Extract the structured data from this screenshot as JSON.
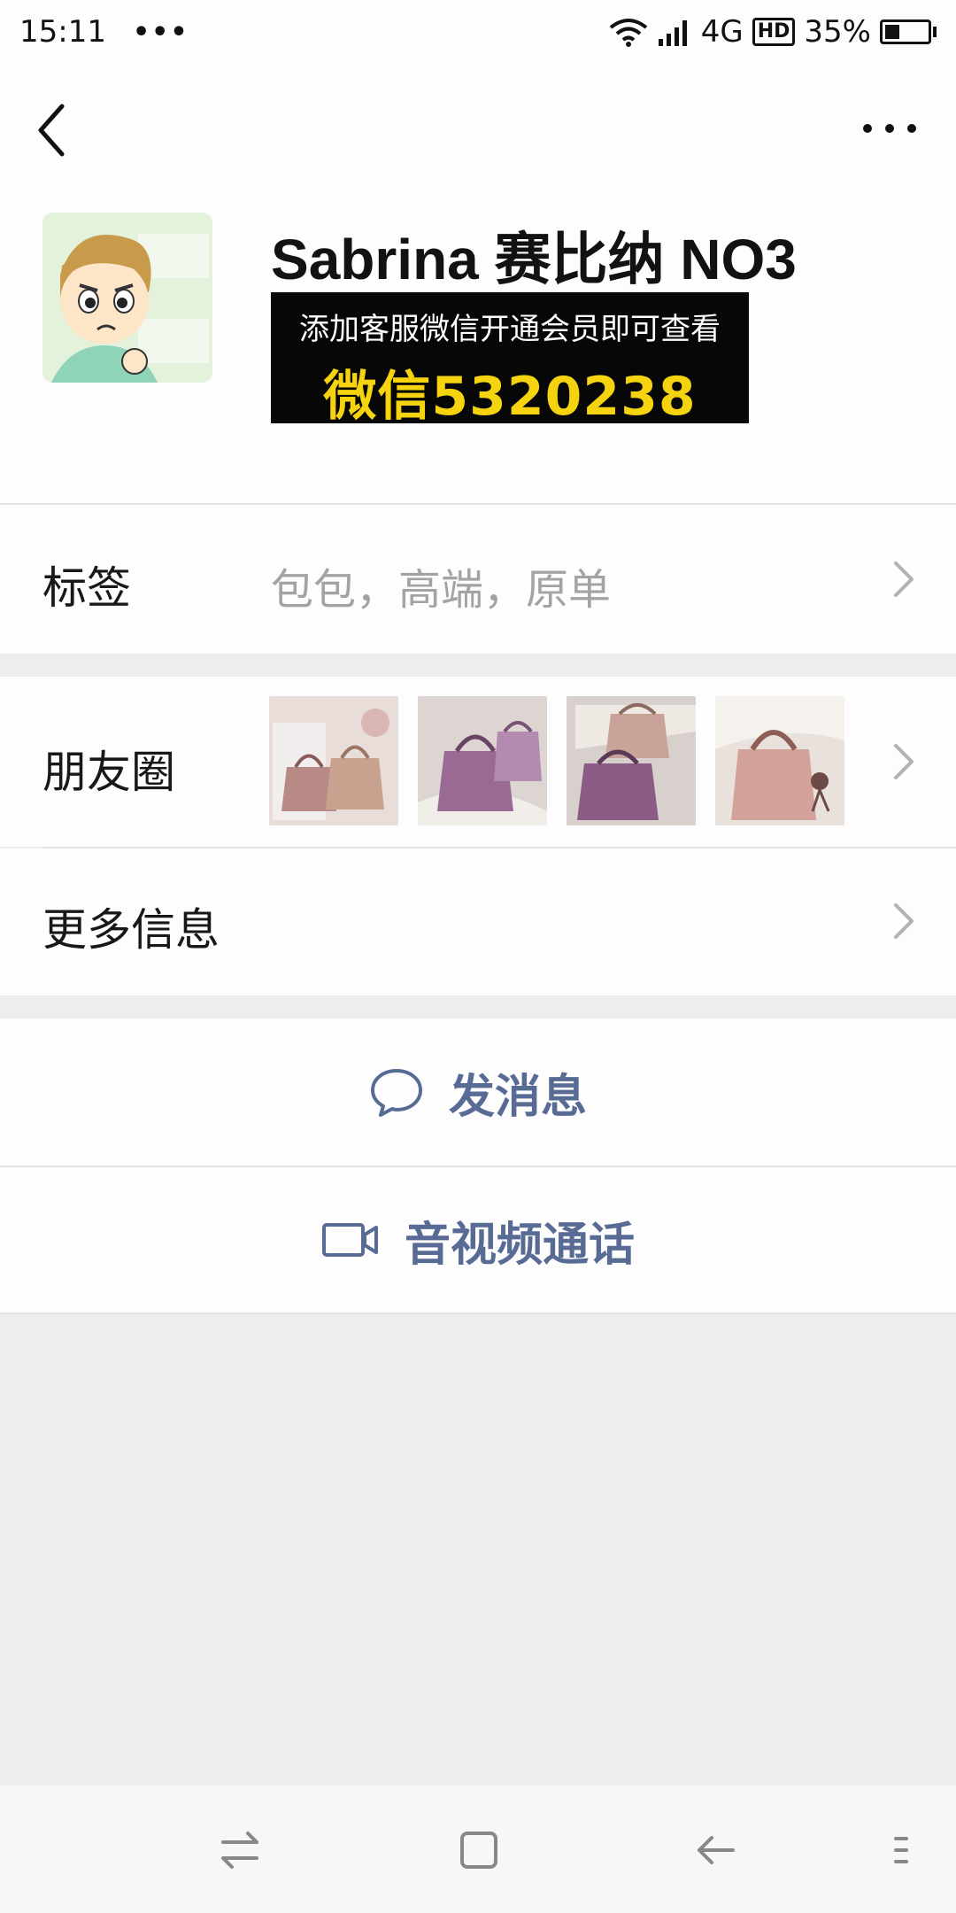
{
  "status_bar": {
    "time": "15:11",
    "dots": "•••",
    "network": "4G",
    "hd": "HD",
    "battery": "35%",
    "battery_level": 0.35
  },
  "nav": {
    "back_icon": "chevron-left-icon",
    "more_icon": "more-horizontal-icon"
  },
  "profile": {
    "name": "Sabrina 赛比纳 NO3",
    "promo_line1": "添加客服微信开通会员即可查看",
    "promo_line2": "微信5320238"
  },
  "tags_row": {
    "label": "标签",
    "value": "包包，高端，原单"
  },
  "moments_row": {
    "label": "朋友圈",
    "thumbnail_count": 4
  },
  "more_info_row": {
    "label": "更多信息"
  },
  "actions": {
    "message": "发消息",
    "video_call": "音视频通话"
  },
  "colors": {
    "link": "#576b95",
    "promo_text": "#f5d30f",
    "background": "#ededed"
  }
}
